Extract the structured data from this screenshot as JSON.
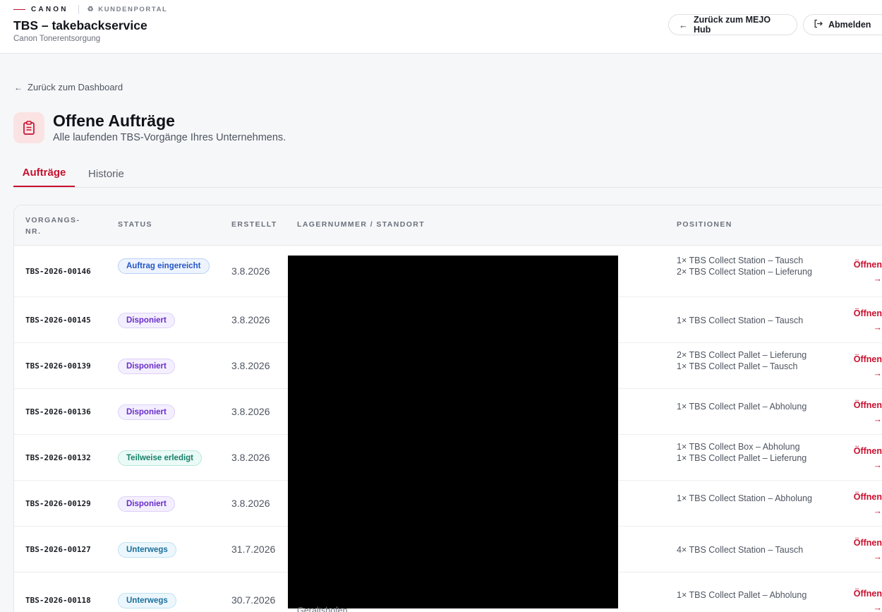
{
  "brand": {
    "name": "CANON",
    "portal": "KUNDENPORTAL",
    "icon": "recycle-icon"
  },
  "app": {
    "title": "TBS – takebackservice",
    "subtitle": "Canon Tonerentsorgung"
  },
  "header_buttons": {
    "hub": "Zurück zum MEJO Hub",
    "logout": "Abmelden"
  },
  "nav": {
    "back": "Zurück zum Dashboard"
  },
  "page": {
    "title": "Offene Aufträge",
    "description": "Alle laufenden TBS-Vorgänge Ihres Unternehmens.",
    "icon": "clipboard-icon"
  },
  "tabs": [
    {
      "label": "Aufträge",
      "active": true
    },
    {
      "label": "Historie",
      "active": false
    }
  ],
  "table": {
    "headers": {
      "nr": "VORGANGS-NR.",
      "status": "STATUS",
      "created": "ERSTELLT",
      "lager": "LAGERNUMMER / STANDORT",
      "positions": "POSITIONEN"
    },
    "open_label": "Öffnen",
    "open_arrow": "→",
    "location_visible_fragment": "Geraltshofen",
    "rows": [
      {
        "nr": "TBS-2026-00146",
        "status": "Auftrag eingereicht",
        "created": "3.8.2026",
        "positions": [
          "1× TBS Collect Station – Tausch",
          "2× TBS Collect Station – Lieferung"
        ]
      },
      {
        "nr": "TBS-2026-00145",
        "status": "Disponiert",
        "created": "3.8.2026",
        "positions": [
          "1× TBS Collect Station – Tausch"
        ]
      },
      {
        "nr": "TBS-2026-00139",
        "status": "Disponiert",
        "created": "3.8.2026",
        "positions": [
          "2× TBS Collect Pallet – Lieferung",
          "1× TBS Collect Pallet – Tausch"
        ]
      },
      {
        "nr": "TBS-2026-00136",
        "status": "Disponiert",
        "created": "3.8.2026",
        "positions": [
          "1× TBS Collect Pallet – Abholung"
        ]
      },
      {
        "nr": "TBS-2026-00132",
        "status": "Teilweise erledigt",
        "created": "3.8.2026",
        "positions": [
          "1× TBS Collect Box – Abholung",
          "1× TBS Collect Pallet – Lieferung"
        ]
      },
      {
        "nr": "TBS-2026-00129",
        "status": "Disponiert",
        "created": "3.8.2026",
        "positions": [
          "1× TBS Collect Station – Abholung"
        ]
      },
      {
        "nr": "TBS-2026-00127",
        "status": "Unterwegs",
        "created": "31.7.2026",
        "positions": [
          "4× TBS Collect Station – Tausch"
        ]
      },
      {
        "nr": "TBS-2026-00118",
        "status": "Unterwegs",
        "created": "30.7.2026",
        "positions": [
          "1× TBS Collect Pallet – Abholung"
        ]
      }
    ]
  },
  "colors": {
    "accent": "#c8102e",
    "status_submitted": "#2556c4",
    "status_dispo": "#6a2fc9",
    "status_partial": "#17806a",
    "status_transit": "#1b6f9a"
  }
}
